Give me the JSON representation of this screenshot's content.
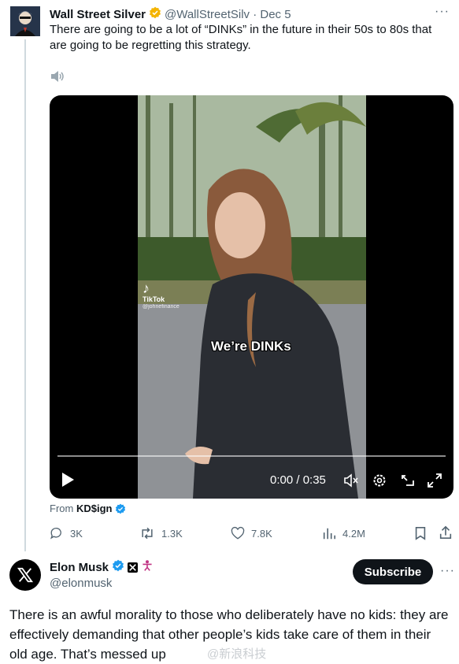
{
  "tweet": {
    "author_name": "Wall Street Silver",
    "handle_date": "@WallStreetSilv · Dec 5",
    "text": "There are going to be a lot of “DINKs” in the future in their 50s to 80s that are going to be regretting this strategy.",
    "video": {
      "watermark_app": "TikTok",
      "watermark_user": "@johnefinance",
      "caption": "We’re DINKs",
      "timecode": "0:00 / 0:35",
      "progress": 0
    },
    "from_label": "From",
    "from_account": "KD$ign",
    "actions": {
      "replies": "3K",
      "reposts": "1.3K",
      "likes": "7.8K",
      "views": "4.2M"
    }
  },
  "reply": {
    "author_name": "Elon Musk",
    "handle": "@elonmusk",
    "subscribe_label": "Subscribe",
    "text": "There is an awful morality to those who deliberately have no kids: they are effectively demanding that other people’s kids take care of them in their old age. That’s messed up",
    "overlay_watermark": "@新浪科技"
  },
  "more_glyph": "···",
  "colors": {
    "verified_blue": "#1d9bf0",
    "verified_gold": "#f4b400",
    "muted": "#536471",
    "text": "#0f1419"
  }
}
